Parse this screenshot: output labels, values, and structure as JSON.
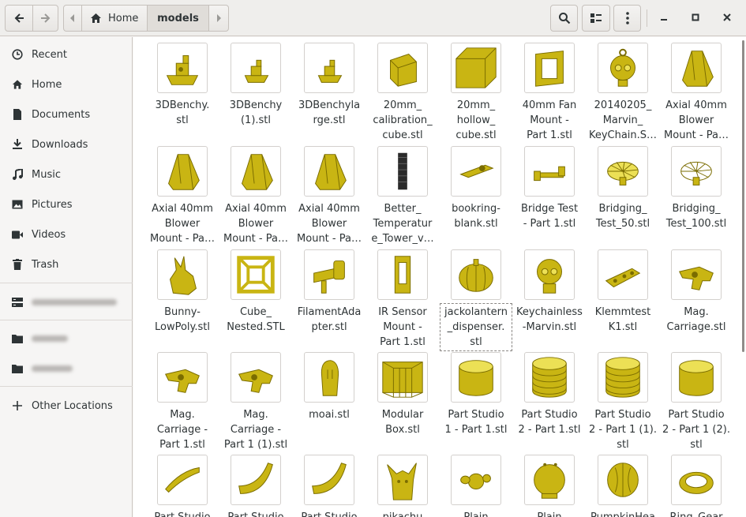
{
  "colors": {
    "model": "#c9b513",
    "model_dark": "#7a6c00",
    "model_light": "#ece055"
  },
  "header": {
    "back_icon": "go-back-icon",
    "forward_icon": "go-forward-icon",
    "breadcrumb": [
      {
        "label": "Home",
        "icon": "home-icon"
      },
      {
        "label": "models"
      }
    ],
    "search_icon": "search-icon",
    "view_icon": "list-view-icon",
    "menu_icon": "kebab-menu-icon"
  },
  "sidebar": {
    "items": [
      {
        "label": "Recent",
        "icon": "clock-icon"
      },
      {
        "label": "Home",
        "icon": "home-icon"
      },
      {
        "label": "Documents",
        "icon": "document-icon"
      },
      {
        "label": "Downloads",
        "icon": "download-icon"
      },
      {
        "label": "Music",
        "icon": "music-icon"
      },
      {
        "label": "Pictures",
        "icon": "picture-icon"
      },
      {
        "label": "Videos",
        "icon": "video-icon"
      },
      {
        "label": "Trash",
        "icon": "trash-icon"
      }
    ],
    "other_locations": "Other Locations"
  },
  "files": [
    {
      "name": "3DBenchy.\nstl",
      "shape": "boat"
    },
    {
      "name": "3DBenchy\n(1).stl",
      "shape": "boat-small"
    },
    {
      "name": "3DBenchyla\nrge.stl",
      "shape": "boat-small"
    },
    {
      "name": "20mm_\ncalibration_\ncube.stl",
      "shape": "cube"
    },
    {
      "name": "20mm_\nhollow_\ncube.stl",
      "shape": "cube-big"
    },
    {
      "name": "40mm Fan\nMount -\nPart 1.stl",
      "shape": "frame"
    },
    {
      "name": "20140205_\nMarvin_\nKeyChain.S…",
      "shape": "head"
    },
    {
      "name": "Axial 40mm\nBlower\nMount - Pa…",
      "shape": "blower"
    },
    {
      "name": "Axial 40mm\nBlower\nMount - Pa…",
      "shape": "blower"
    },
    {
      "name": "Axial 40mm\nBlower\nMount - Pa…",
      "shape": "blower"
    },
    {
      "name": "Axial 40mm\nBlower\nMount - Pa…",
      "shape": "blower"
    },
    {
      "name": "Better_\nTemperatur\ne_Tower_v…",
      "shape": "tower"
    },
    {
      "name": "bookring-\nblank.stl",
      "shape": "ring-blank"
    },
    {
      "name": "Bridge Test\n- Part 1.stl",
      "shape": "bridge"
    },
    {
      "name": "Bridging_\nTest_50.stl",
      "shape": "fan"
    },
    {
      "name": "Bridging_\nTest_100.stl",
      "shape": "fan-light"
    },
    {
      "name": "Bunny-\nLowPoly.stl",
      "shape": "bunny"
    },
    {
      "name": "Cube_\nNested.STL",
      "shape": "nested"
    },
    {
      "name": "FilamentAda\npter.stl",
      "shape": "adapter"
    },
    {
      "name": "IR Sensor\nMount -\nPart 1.stl",
      "shape": "sensor"
    },
    {
      "name": "jackolantern\n_dispenser.\nstl",
      "shape": "pumpkin"
    },
    {
      "name": "Keychainless\n-Marvin.stl",
      "shape": "marvin"
    },
    {
      "name": "Klemmtest\nK1.stl",
      "shape": "clamp"
    },
    {
      "name": "Mag.\nCarriage.stl",
      "shape": "carriage"
    },
    {
      "name": "Mag.\nCarriage -\nPart 1.stl",
      "shape": "carriage"
    },
    {
      "name": "Mag.\nCarriage -\nPart 1 (1).stl",
      "shape": "carriage"
    },
    {
      "name": "moai.stl",
      "shape": "moai"
    },
    {
      "name": "Modular\nBox.stl",
      "shape": "box"
    },
    {
      "name": "Part Studio\n1 - Part 1.stl",
      "shape": "cylinder"
    },
    {
      "name": "Part Studio\n2 - Part 1.stl",
      "shape": "cylinder-ribbed"
    },
    {
      "name": "Part Studio\n2 - Part 1 (1).\nstl",
      "shape": "cylinder-ribbed"
    },
    {
      "name": "Part Studio\n2 - Part 1 (2).\nstl",
      "shape": "cylinder"
    },
    {
      "name": "Part Studio",
      "shape": "arc-flat"
    },
    {
      "name": "Part Studio",
      "shape": "arc"
    },
    {
      "name": "Part Studio",
      "shape": "arc"
    },
    {
      "name": "pikachu",
      "shape": "pikachu"
    },
    {
      "name": "Plain",
      "shape": "plain-small"
    },
    {
      "name": "Plain",
      "shape": "plain-round"
    },
    {
      "name": "PumpkinHea",
      "shape": "pumpkin-head"
    },
    {
      "name": "Ring_Gear",
      "shape": "ring"
    }
  ]
}
